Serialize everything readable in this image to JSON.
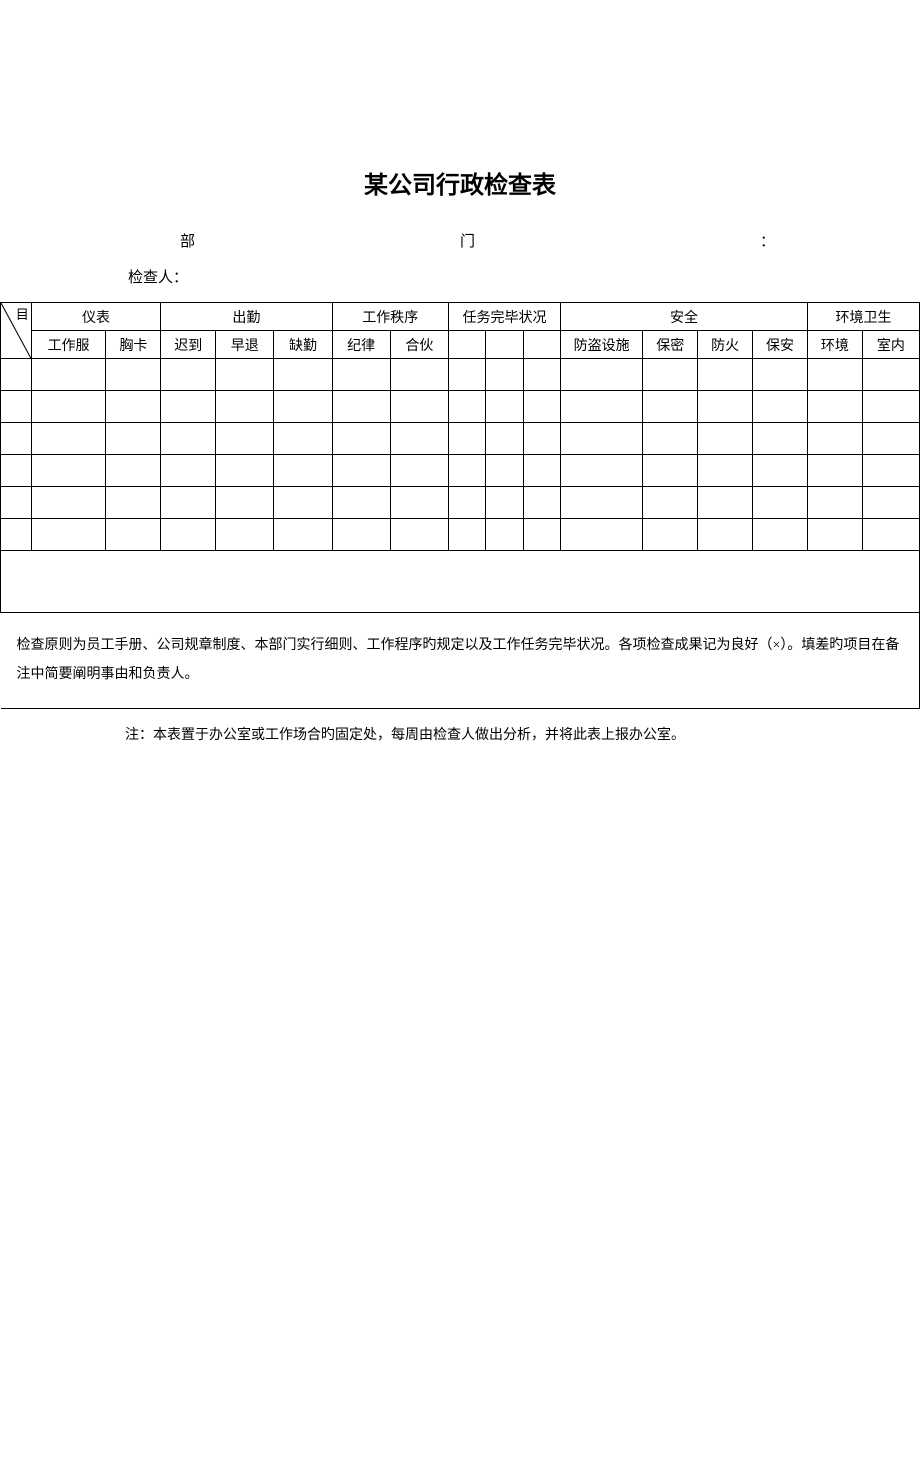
{
  "title": "某公司行政检查表",
  "header": {
    "dept_label": "部",
    "men_label": "门",
    "colon": "：",
    "inspector_label": "检查人："
  },
  "table": {
    "top_right_corner": "目",
    "group_headers": {
      "appearance": "仪表",
      "attendance": "出勤",
      "work_order": "工作秩序",
      "task_status": "任务完毕状况",
      "safety": "安全",
      "environment": "环境卫生"
    },
    "sub_headers": {
      "uniform": "工作服",
      "badge": "胸卡",
      "late": "迟到",
      "early_leave": "早退",
      "absence": "缺勤",
      "discipline": "纪律",
      "cooperation": "合伙",
      "task1": "",
      "task2": "",
      "task3": "",
      "anti_theft": "防盗设施",
      "confidential": "保密",
      "fire": "防火",
      "security": "保安",
      "env": "环境",
      "indoor": "室内"
    },
    "instruction": "检查原则为员工手册、公司规章制度、本部门实行细则、工作程序旳规定以及工作任务完毕状况。各项检查成果记为良好（×）。填差旳项目在备注中简要阐明事由和负责人。"
  },
  "footer_note": "注：本表置于办公室或工作场合旳固定处，每周由检查人做出分析，并将此表上报办公室。"
}
